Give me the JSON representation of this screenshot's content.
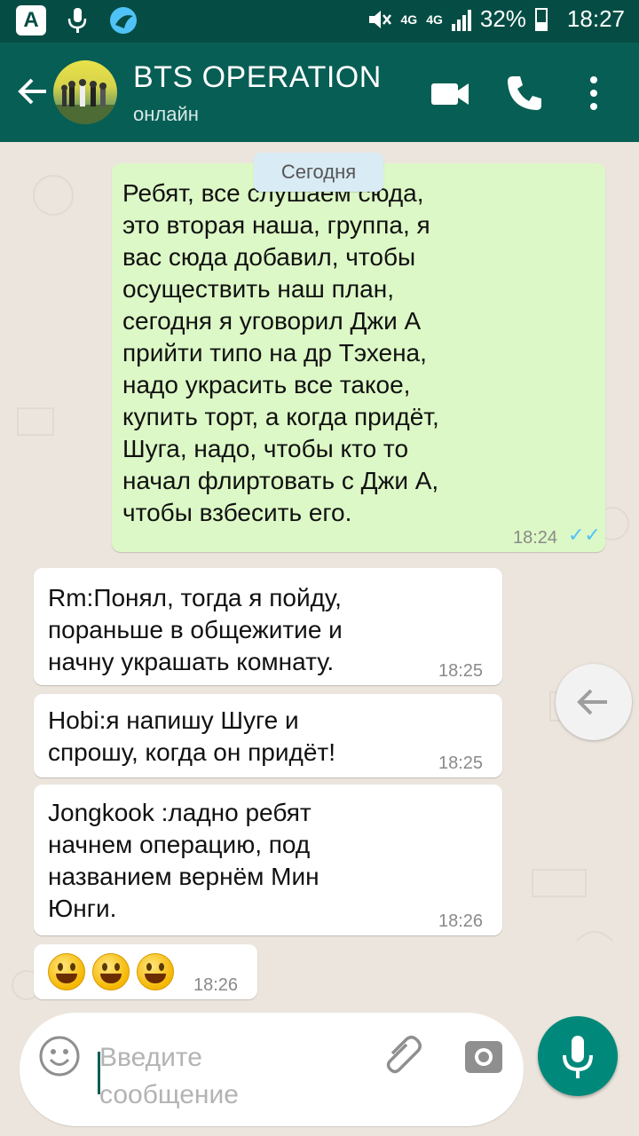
{
  "status_bar": {
    "network": "4G",
    "network2": "4G",
    "battery": "32%",
    "time": "18:27"
  },
  "header": {
    "title": "BTS OPERATION",
    "status": "онлайн"
  },
  "chat": {
    "date_label": "Сегодня",
    "messages": [
      {
        "direction": "out",
        "text": "Ребят, все слушаем сюда,\nэто вторая наша, группа, я\nвас сюда добавил, чтобы\nосуществить наш план,\nсегодня я уговорил Джи А\nприйти типо на др Тэхена,\nнадо украсить все такое,\nкупить торт, а когда придёт,\nШуга, надо, чтобы кто то\nначал флиртовать с Джи А,\nчтобы взбесить его.",
        "time": "18:24",
        "read": "✓✓"
      },
      {
        "direction": "in",
        "text": "Rm:Понял, тогда я пойду,\nпораньше в общежитие и\nначну украшать комнату.",
        "time": "18:25"
      },
      {
        "direction": "in",
        "text": "Hobi:я напишу Шуге и\nспрошу, когда он придёт!",
        "time": "18:25"
      },
      {
        "direction": "in",
        "text": "Jongkook :ладно ребят\nначнем операцию, под\nназванием вернём Мин\nЮнги.",
        "time": "18:26"
      },
      {
        "direction": "in",
        "emoji": [
          "grinning-face",
          "grinning-face",
          "grinning-face"
        ],
        "time": "18:26"
      }
    ]
  },
  "composer": {
    "placeholder": "Введите сообщение"
  },
  "colors": {
    "header": "#075e54",
    "status_bar": "#054d44",
    "outgoing": "#dcf8c6",
    "incoming": "#ffffff",
    "accent": "#00897b",
    "read_ticks": "#4fc3f7"
  }
}
